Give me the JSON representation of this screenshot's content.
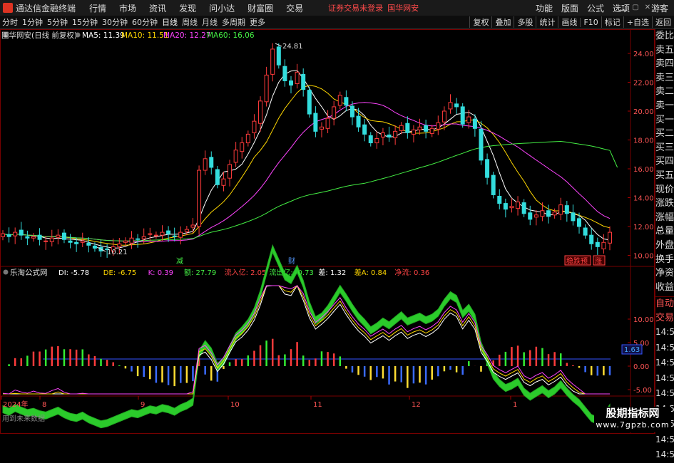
{
  "window": {
    "title": "通达信金融终端",
    "menu": [
      "行情",
      "市场",
      "资讯",
      "发现",
      "问小达",
      "财富圈",
      "交易"
    ],
    "status": "证券交易未登录",
    "stock_name": "国华网安",
    "right_menu": [
      "功能",
      "版面",
      "公式",
      "选项"
    ],
    "guest": "游客"
  },
  "toolbar": {
    "periods": [
      "分时",
      "1分钟",
      "5分钟",
      "15分钟",
      "30分钟",
      "60分钟",
      "日线",
      "周线",
      "月线",
      "多周期",
      "更多"
    ],
    "active_period": "日线",
    "right_buttons": [
      "复权",
      "叠加",
      "多股",
      "统计",
      "画线",
      "F10",
      "标记",
      "+自选",
      "返回"
    ]
  },
  "main_chart": {
    "legend_title": "国华网安(日线 前复权)",
    "ma": [
      {
        "label": "MA5: 11.39",
        "color": "#ffffff"
      },
      {
        "label": "MA10: 11.51",
        "color": "#ffd700"
      },
      {
        "label": "MA20: 12.27",
        "color": "#ff44ff"
      },
      {
        "label": "MA60: 16.06",
        "color": "#44ee44"
      }
    ],
    "high_label": "24.81",
    "low_label": "10.21",
    "y_ticks": [
      "24.00",
      "22.00",
      "20.00",
      "18.00",
      "16.00",
      "14.00",
      "12.00",
      "10.00"
    ],
    "markers": [
      {
        "text": "减",
        "color": "#44ee44"
      },
      {
        "text": "财",
        "color": "#5599ff"
      },
      {
        "text": "稳跌预",
        "color": "#ff4444"
      },
      {
        "text": "涨",
        "color": "#ff4444"
      }
    ]
  },
  "indicator": {
    "name": "乐淘公式网",
    "values": [
      {
        "label": "DI: -5.78",
        "color": "#ffffff"
      },
      {
        "label": "DE: -6.75",
        "color": "#ffd700"
      },
      {
        "label": "K: 0.39",
        "color": "#ff44ff"
      },
      {
        "label": "额: 27.79",
        "color": "#44ee44"
      },
      {
        "label": "流入亿: 2.05",
        "color": "#ff4444"
      },
      {
        "label": "流出亿: -0.73",
        "color": "#44ee44"
      },
      {
        "label": "差: 1.32",
        "color": "#ffffff"
      },
      {
        "label": "差A: 0.84",
        "color": "#ffd700"
      },
      {
        "label": "净流: 0.36",
        "color": "#ff4444"
      }
    ],
    "y_ticks": [
      "10.00",
      "5.00",
      "0.00",
      "-5.00"
    ],
    "current": "1.63",
    "footnote": "用到未来数据"
  },
  "x_axis": [
    "2024年",
    "8",
    "9",
    "10",
    "11",
    "12",
    "1"
  ],
  "side_panel": {
    "items": [
      "委比",
      "卖五",
      "卖四",
      "卖三",
      "卖二",
      "卖一",
      "买一",
      "买二",
      "买三",
      "买四",
      "买五",
      "现价",
      "涨跌",
      "涨幅",
      "总量",
      "外盘",
      "换手",
      "净资",
      "收益"
    ],
    "items2": [
      "自动",
      "交易"
    ],
    "times": [
      "14:56",
      "14:56",
      "14:56",
      "14:56",
      "14:56",
      "14:56",
      "14:56",
      "14:56",
      "14:56"
    ]
  },
  "watermark": {
    "line1": "股期指标网",
    "line2": "www.7gpzb.com"
  }
}
